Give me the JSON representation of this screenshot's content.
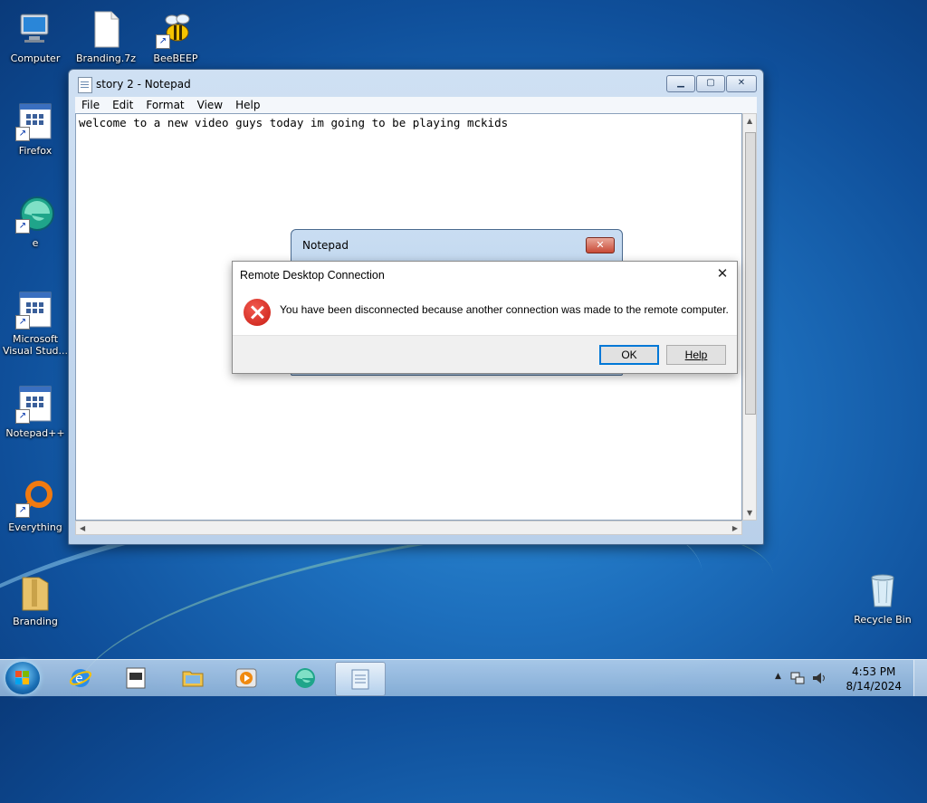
{
  "desktop": {
    "icons": [
      {
        "label": "Computer"
      },
      {
        "label": "Branding.7z"
      },
      {
        "label": "BeeBEEP"
      },
      {
        "label": "Firefox"
      },
      {
        "label": "e"
      },
      {
        "label": "Microsoft Visual Stud..."
      },
      {
        "label": "Notepad++"
      },
      {
        "label": "Everything"
      },
      {
        "label": "Branding"
      },
      {
        "label": "Recycle Bin"
      }
    ]
  },
  "notepad": {
    "title": "story 2 - Notepad",
    "menu": [
      "File",
      "Edit",
      "Format",
      "View",
      "Help"
    ],
    "content": "welcome to a new video guys today im going to be playing mckids"
  },
  "notepad_dialog": {
    "title": "Notepad"
  },
  "rdc_dialog": {
    "title": "Remote Desktop Connection",
    "message": "You have been disconnected because another connection was made to the remote computer.",
    "ok_label": "OK",
    "help_label": "Help"
  },
  "taskbar": {
    "time": "4:53 PM",
    "date": "8/14/2024",
    "pinned": [
      "start-orb",
      "internet-explorer-icon",
      "app-icon",
      "file-explorer-icon",
      "media-player-icon",
      "edge-icon",
      "notepad-icon"
    ]
  },
  "colors": {
    "desktop_bg": "#1d6fbd",
    "error_red": "#c81d13",
    "default_button_border": "#0078d7"
  }
}
